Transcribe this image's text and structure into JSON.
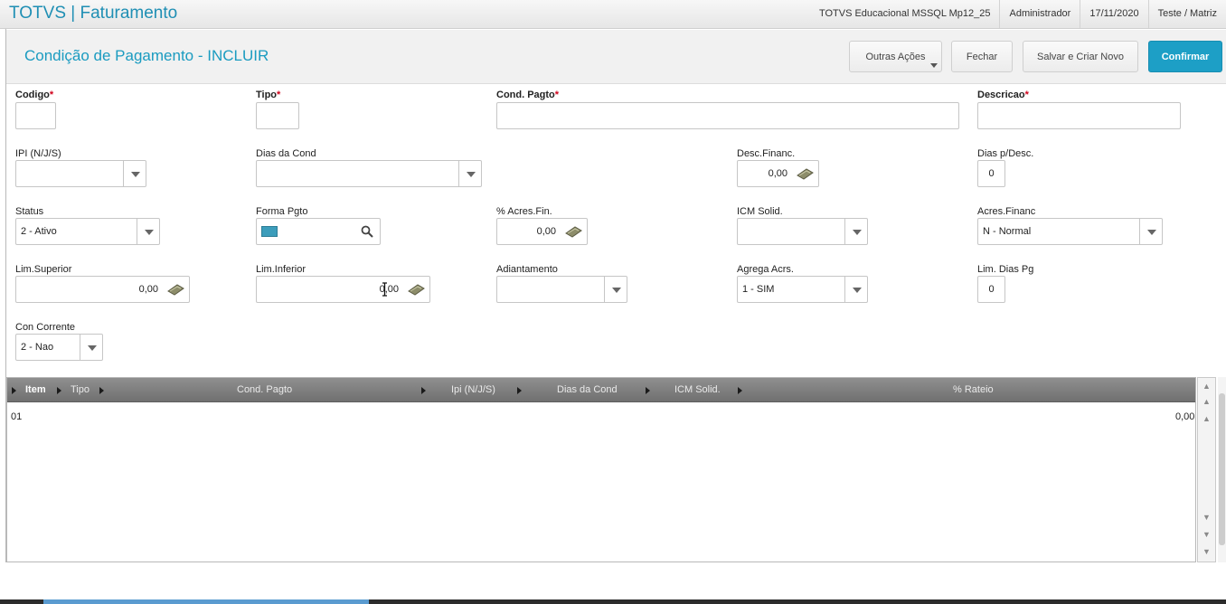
{
  "app": {
    "title": "TOTVS | Faturamento",
    "environment": "TOTVS Educacional MSSQL Mp12_25",
    "user": "Administrador",
    "date": "17/11/2020",
    "branch": "Teste / Matriz"
  },
  "page": {
    "title": "Condição de Pagamento - INCLUIR"
  },
  "actions": {
    "more_actions": "Outras Ações",
    "close": "Fechar",
    "save_new": "Salvar e Criar Novo",
    "confirm": "Confirmar"
  },
  "required_mark": "*",
  "form": {
    "codigo": {
      "label": "Codigo",
      "value": ""
    },
    "tipo": {
      "label": "Tipo",
      "value": ""
    },
    "cond_pagto": {
      "label": "Cond. Pagto",
      "value": ""
    },
    "descricao": {
      "label": "Descricao",
      "value": ""
    },
    "ipi": {
      "label": "IPI (N/J/S)",
      "value": ""
    },
    "dias_cond": {
      "label": "Dias da Cond",
      "value": ""
    },
    "desc_financ": {
      "label": "Desc.Financ.",
      "value": "0,00"
    },
    "dias_desc": {
      "label": "Dias p/Desc.",
      "value": "0"
    },
    "status": {
      "label": "Status",
      "value": "2 - Ativo"
    },
    "forma_pgto": {
      "label": "Forma Pgto",
      "value": ""
    },
    "acres_fin": {
      "label": "% Acres.Fin.",
      "value": "0,00"
    },
    "icm_solid": {
      "label": "ICM Solid.",
      "value": ""
    },
    "acres_financ": {
      "label": "Acres.Financ",
      "value": "N - Normal"
    },
    "lim_superior": {
      "label": "Lim.Superior",
      "value": "0,00"
    },
    "lim_inferior": {
      "label": "Lim.Inferior",
      "value": "0,00"
    },
    "adiantamento": {
      "label": "Adiantamento",
      "value": ""
    },
    "agrega_acrs": {
      "label": "Agrega Acrs.",
      "value": "1 - SIM"
    },
    "lim_dias_pg": {
      "label": "Lim. Dias Pg",
      "value": "0"
    },
    "con_corrente": {
      "label": "Con Corrente",
      "value": "2 - Nao"
    }
  },
  "grid": {
    "columns": [
      "Item",
      "Tipo",
      "Cond. Pagto",
      "Ipi (N/J/S)",
      "Dias da Cond",
      "ICM Solid.",
      "% Rateio"
    ],
    "rows": [
      {
        "item": "01",
        "rateio": "0,00"
      }
    ]
  }
}
